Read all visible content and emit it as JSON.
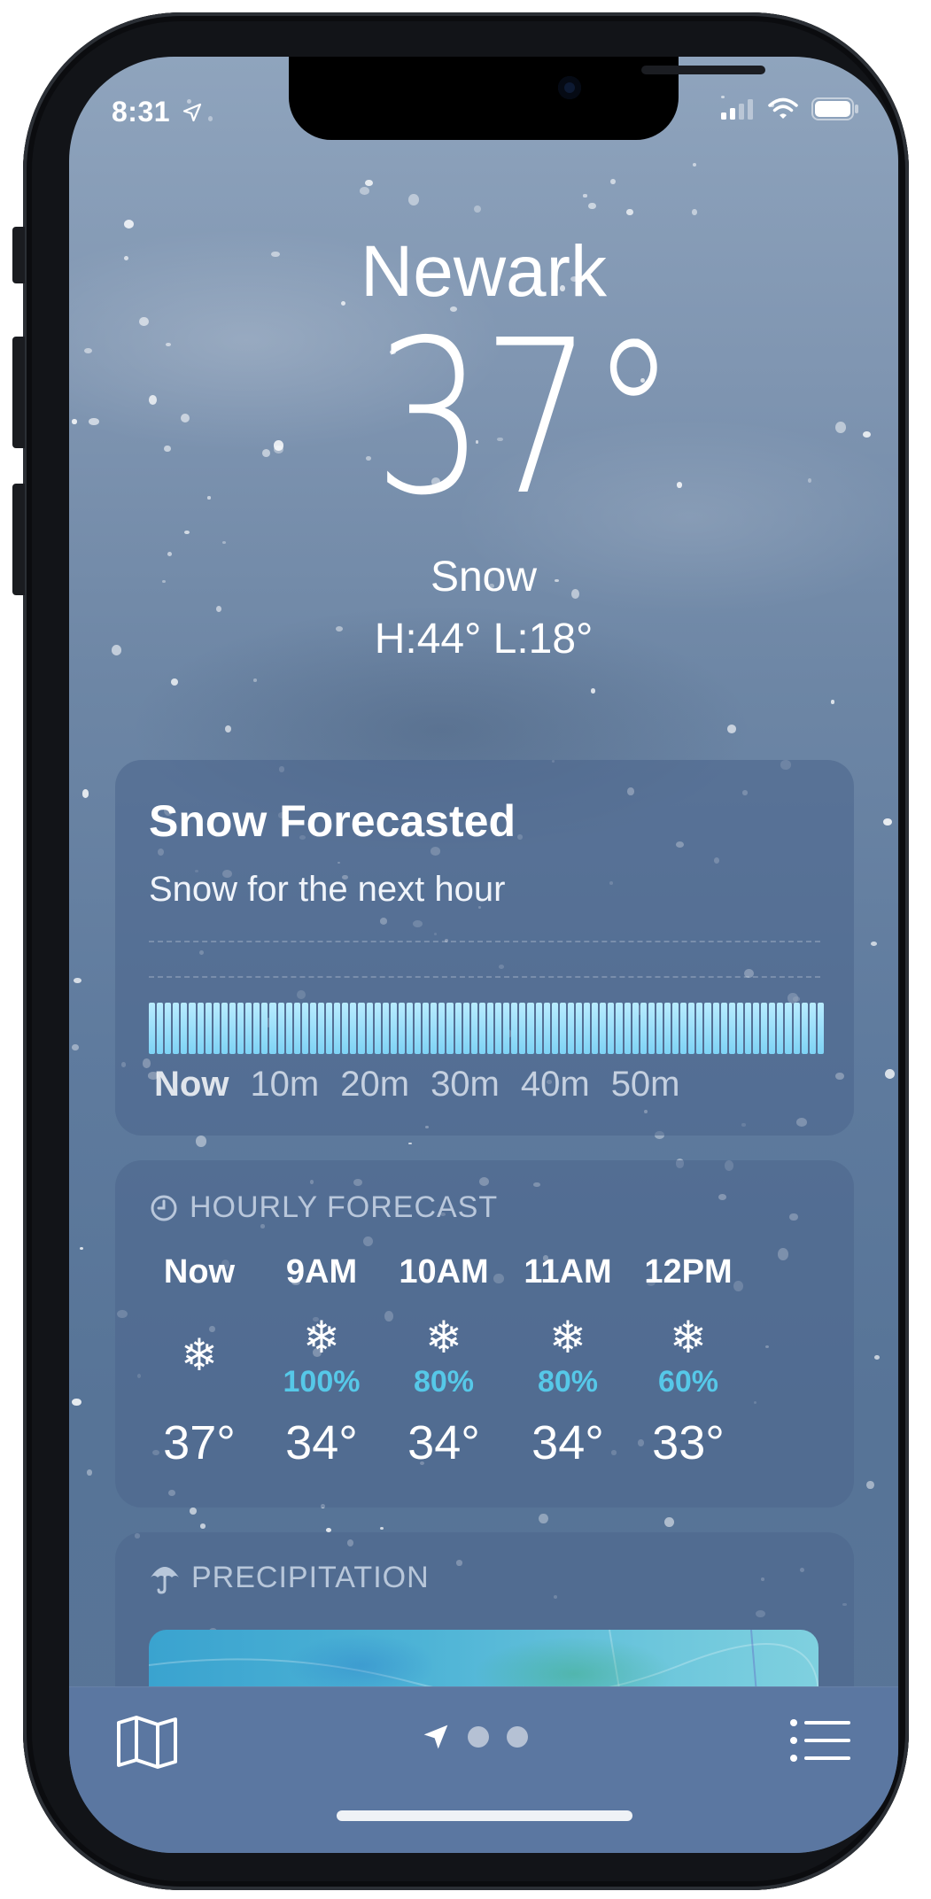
{
  "status_bar": {
    "time": "8:31",
    "location_icon": "location-arrow-icon",
    "signal_icon": "cellular-signal-icon",
    "wifi_icon": "wifi-icon",
    "battery_icon": "battery-icon"
  },
  "header": {
    "city": "Newark",
    "temperature": "37°",
    "condition": "Snow",
    "high_low": "H:44°  L:18°"
  },
  "next_hour": {
    "title": "Snow Forecasted",
    "subtitle": "Snow for the next hour",
    "intensity": 1.0,
    "axis": [
      "Now",
      "10m",
      "20m",
      "30m",
      "40m",
      "50m"
    ]
  },
  "hourly": {
    "header": "HOURLY FORECAST",
    "icon": "clock-icon",
    "items": [
      {
        "label": "Now",
        "icon": "snowflake-icon",
        "glyph": "❄",
        "pct": "",
        "temp": "37°"
      },
      {
        "label": "9AM",
        "icon": "snowflake-icon",
        "glyph": "❄",
        "pct": "100%",
        "temp": "34°"
      },
      {
        "label": "10AM",
        "icon": "snowflake-icon",
        "glyph": "❄",
        "pct": "80%",
        "temp": "34°"
      },
      {
        "label": "11AM",
        "icon": "snowflake-icon",
        "glyph": "❄",
        "pct": "80%",
        "temp": "34°"
      },
      {
        "label": "12PM",
        "icon": "snowflake-icon",
        "glyph": "❄",
        "pct": "60%",
        "temp": "33°"
      }
    ]
  },
  "precipitation": {
    "header": "PRECIPITATION",
    "icon": "umbrella-icon"
  },
  "toolbar": {
    "map_icon": "map-icon",
    "location_icon": "location-arrow-icon",
    "list_icon": "list-icon",
    "pages": 3
  },
  "colors": {
    "sky_top": "#8fa4bd",
    "card": "#4e688e",
    "precip_accent": "#56c8e8",
    "toolbar": "#5b77a1"
  }
}
